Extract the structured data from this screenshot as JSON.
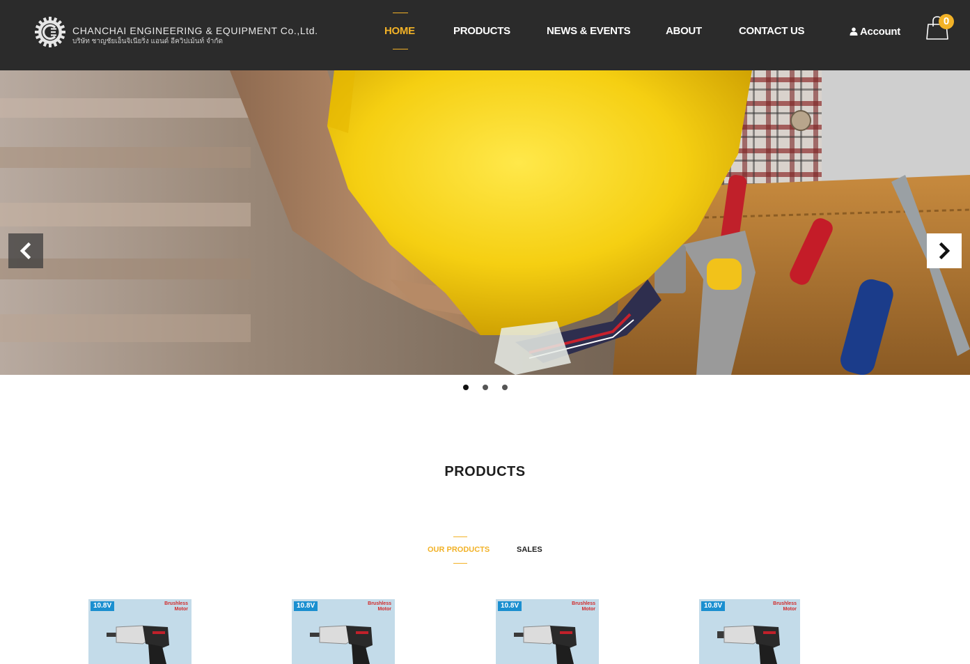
{
  "header": {
    "brand_name": "CHANCHAI ENGINEERING & EQUIPMENT Co.,Ltd.",
    "brand_subtitle": "บริษัท ชาญชัยเอ็นจิเนียริ่ง แอนด์ อีควิปเม้นท์ จำกัด",
    "nav": [
      {
        "label": "HOME",
        "active": true
      },
      {
        "label": "PRODUCTS",
        "active": false
      },
      {
        "label": "NEWS & EVENTS",
        "active": false
      },
      {
        "label": "ABOUT",
        "active": false
      },
      {
        "label": "CONTACT US",
        "active": false
      }
    ],
    "account_label": "Account",
    "cart_count": "0"
  },
  "hero": {
    "slides_total": 3,
    "active_slide": 1
  },
  "products": {
    "title": "PRODUCTS",
    "tabs": [
      {
        "label": "OUR PRODUCTS",
        "active": true
      },
      {
        "label": "SALES",
        "active": false
      }
    ],
    "items": [
      {
        "voltage": "10.8V",
        "feature": "Brushless Motor"
      },
      {
        "voltage": "10.8V",
        "feature": "Brushless Motor"
      },
      {
        "voltage": "10.8V",
        "feature": "Brushless Motor"
      },
      {
        "voltage": "10.8V",
        "feature": "Brushless Motor"
      }
    ]
  },
  "colors": {
    "header_bg": "#2b2b2b",
    "accent": "#f2b227",
    "card_bg": "#c3dbe9"
  },
  "icons": {
    "logo": "gear-logo-icon",
    "account": "user-icon",
    "cart": "shopping-bag-icon",
    "prev": "chevron-left-icon",
    "next": "chevron-right-icon"
  }
}
